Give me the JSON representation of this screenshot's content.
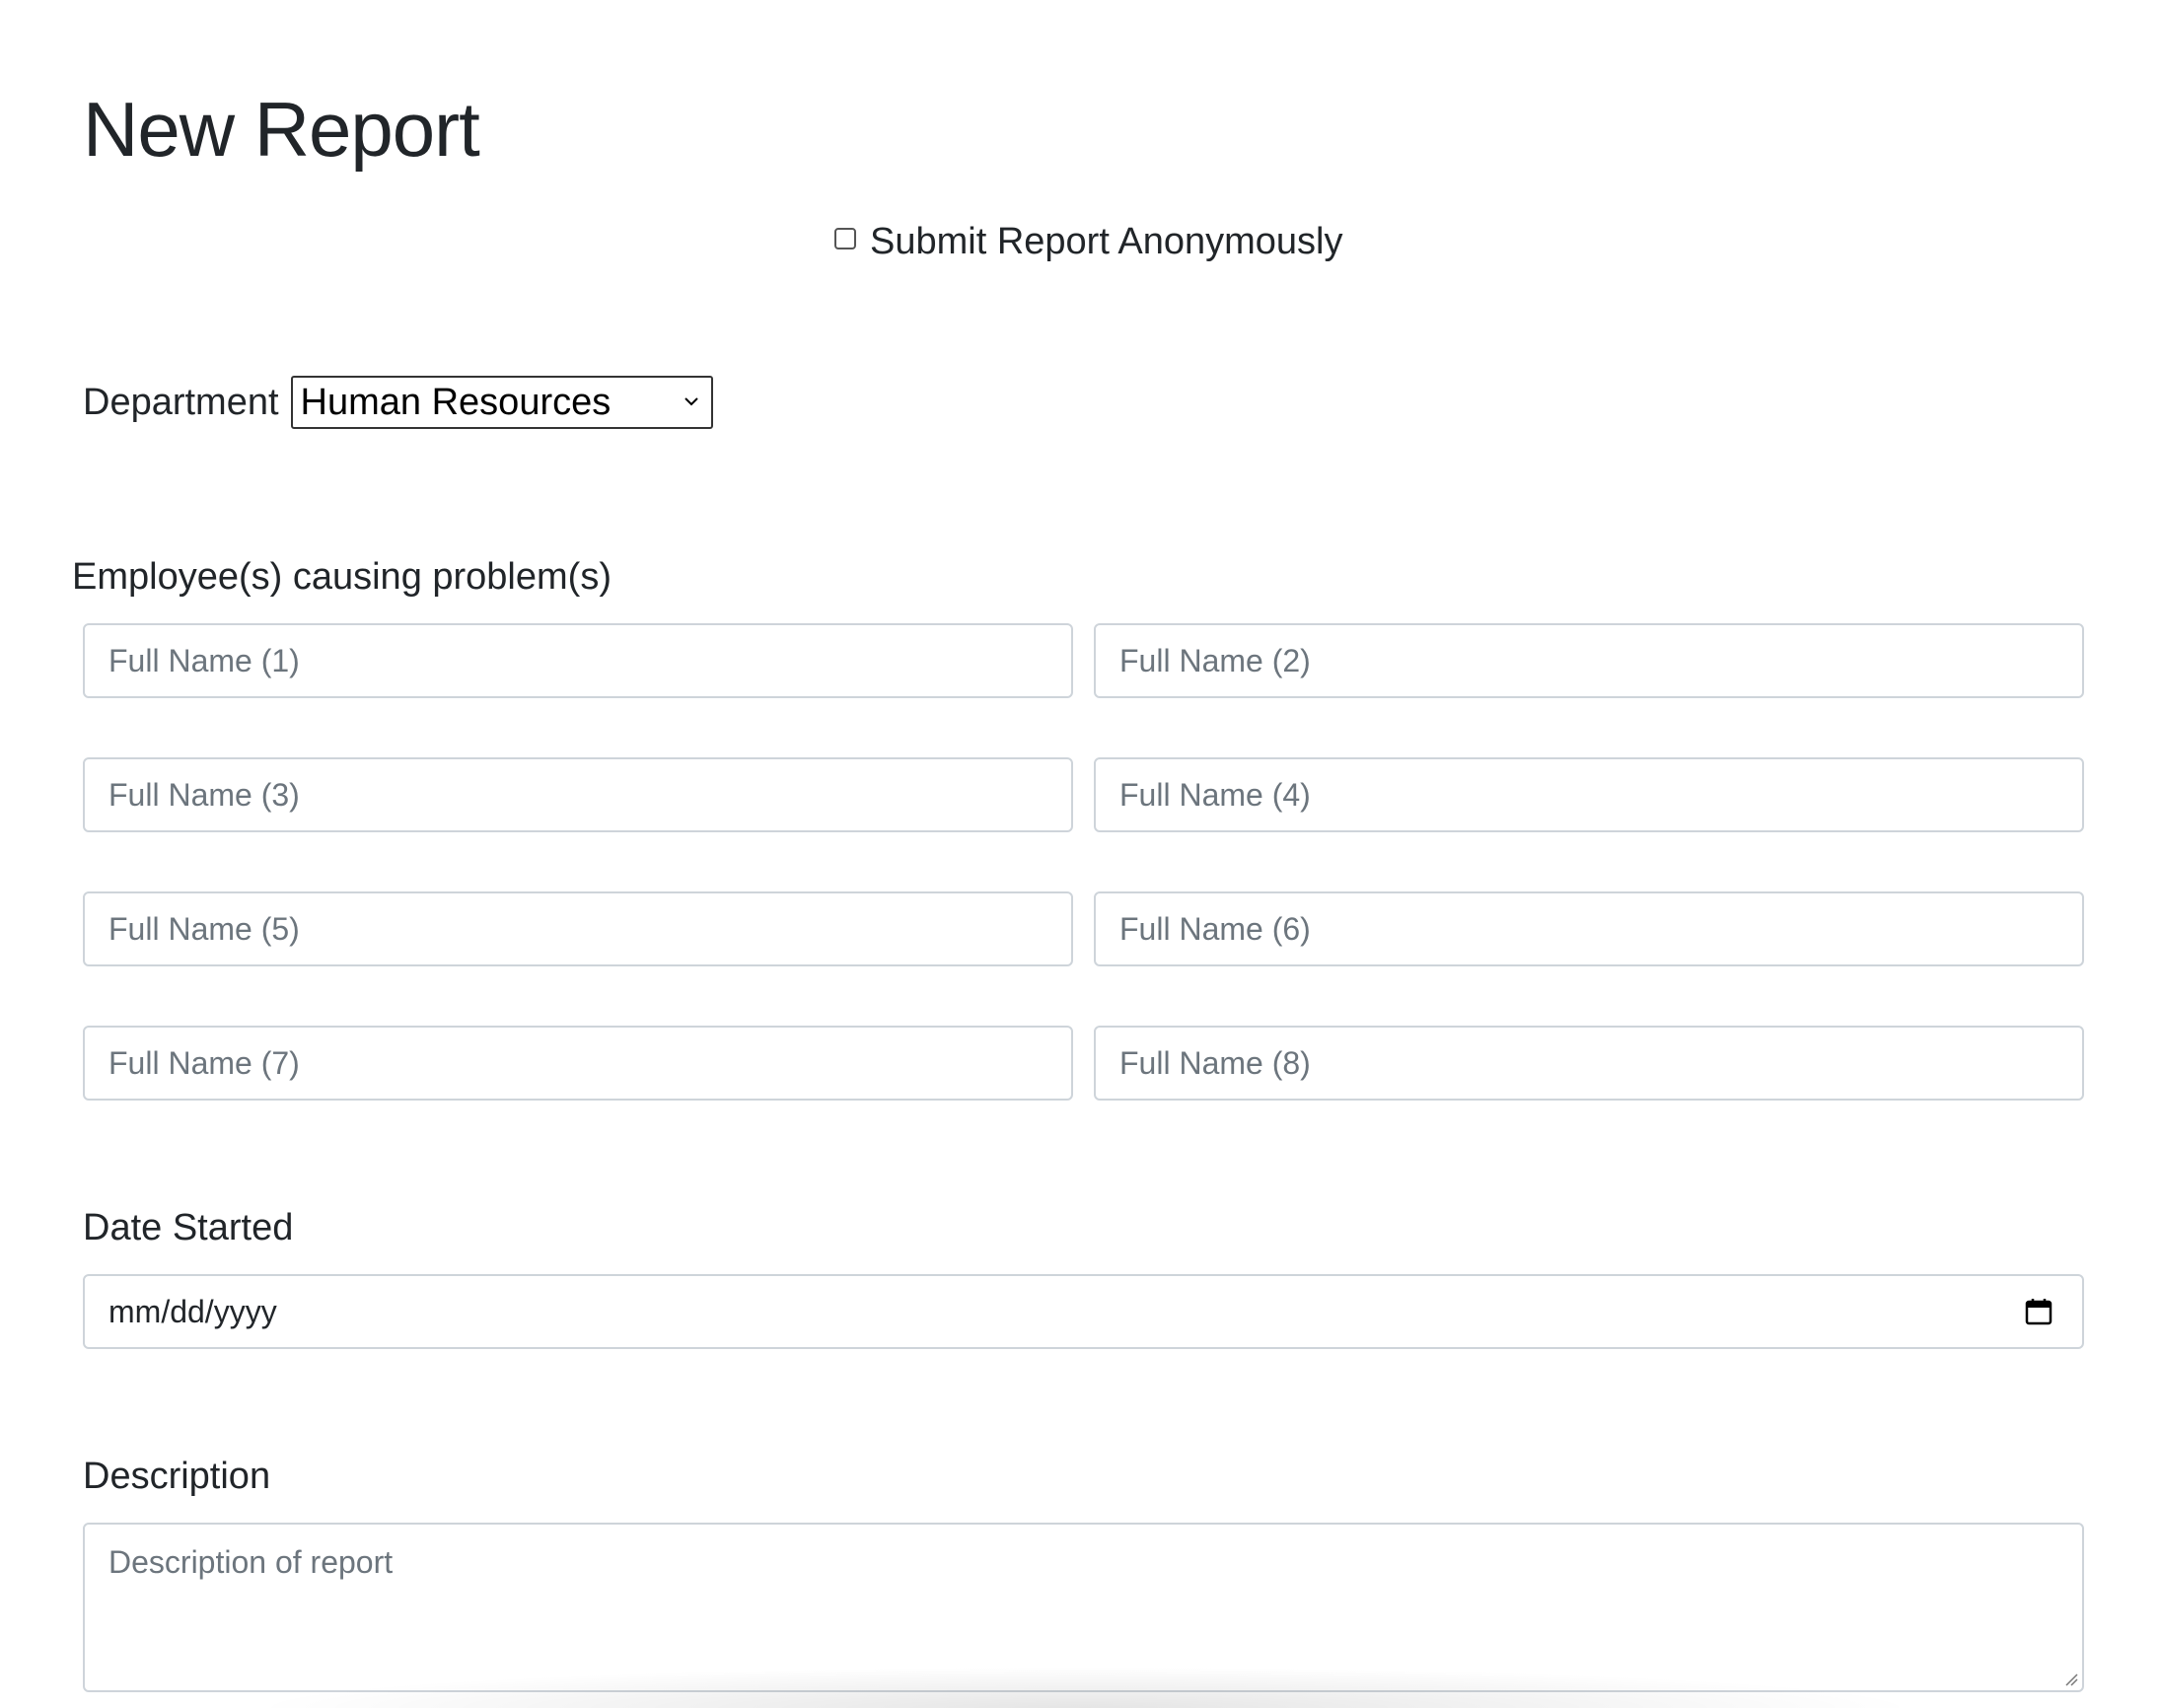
{
  "page": {
    "title": "New Report"
  },
  "anonymous": {
    "label": "Submit Report Anonymously",
    "checked": false
  },
  "department": {
    "label": "Department",
    "selected": "Human Resources"
  },
  "employees": {
    "label": "Employee(s) causing problem(s)",
    "fields": [
      {
        "placeholder": "Full Name (1)"
      },
      {
        "placeholder": "Full Name (2)"
      },
      {
        "placeholder": "Full Name (3)"
      },
      {
        "placeholder": "Full Name (4)"
      },
      {
        "placeholder": "Full Name (5)"
      },
      {
        "placeholder": "Full Name (6)"
      },
      {
        "placeholder": "Full Name (7)"
      },
      {
        "placeholder": "Full Name (8)"
      }
    ]
  },
  "date_started": {
    "label": "Date Started",
    "placeholder": "mm/dd/yyyy"
  },
  "description": {
    "label": "Description",
    "placeholder": "Description of report"
  },
  "icons": {
    "dropdown": "chevron-down-icon",
    "calendar": "calendar-icon",
    "resize": "resize-grip-icon"
  }
}
